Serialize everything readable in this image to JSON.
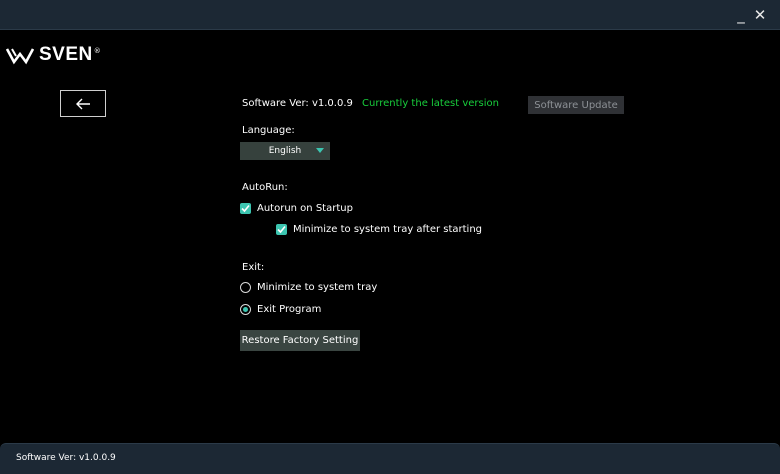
{
  "window": {
    "minimize_symbol": "_",
    "close_symbol": "✕"
  },
  "brand": {
    "name": "SVEN",
    "registered_mark": "®",
    "logo_icon": "sven-wing-logo-icon"
  },
  "navigation": {
    "back_icon": "arrow-left-icon"
  },
  "software": {
    "version_label": "Software Ver: v1.0.0.9",
    "status": "Currently the latest version",
    "update_button": "Software Update"
  },
  "language": {
    "label": "Language:",
    "selected": "English"
  },
  "autorun": {
    "label": "AutoRun:",
    "startup_option": "Autorun on Startup",
    "startup_checked": true,
    "tray_option": "Minimize to system tray after starting",
    "tray_checked": true
  },
  "exit": {
    "label": "Exit:",
    "options": [
      "Minimize to system tray",
      "Exit Program"
    ],
    "selected_index": 1
  },
  "restore_button": "Restore Factory Setting",
  "status_bar": {
    "version_text": "Software Ver: v1.0.0.9"
  },
  "colors": {
    "accent": "#3cc5b0",
    "status_green": "#18cf3c",
    "chrome": "#1c2834"
  }
}
